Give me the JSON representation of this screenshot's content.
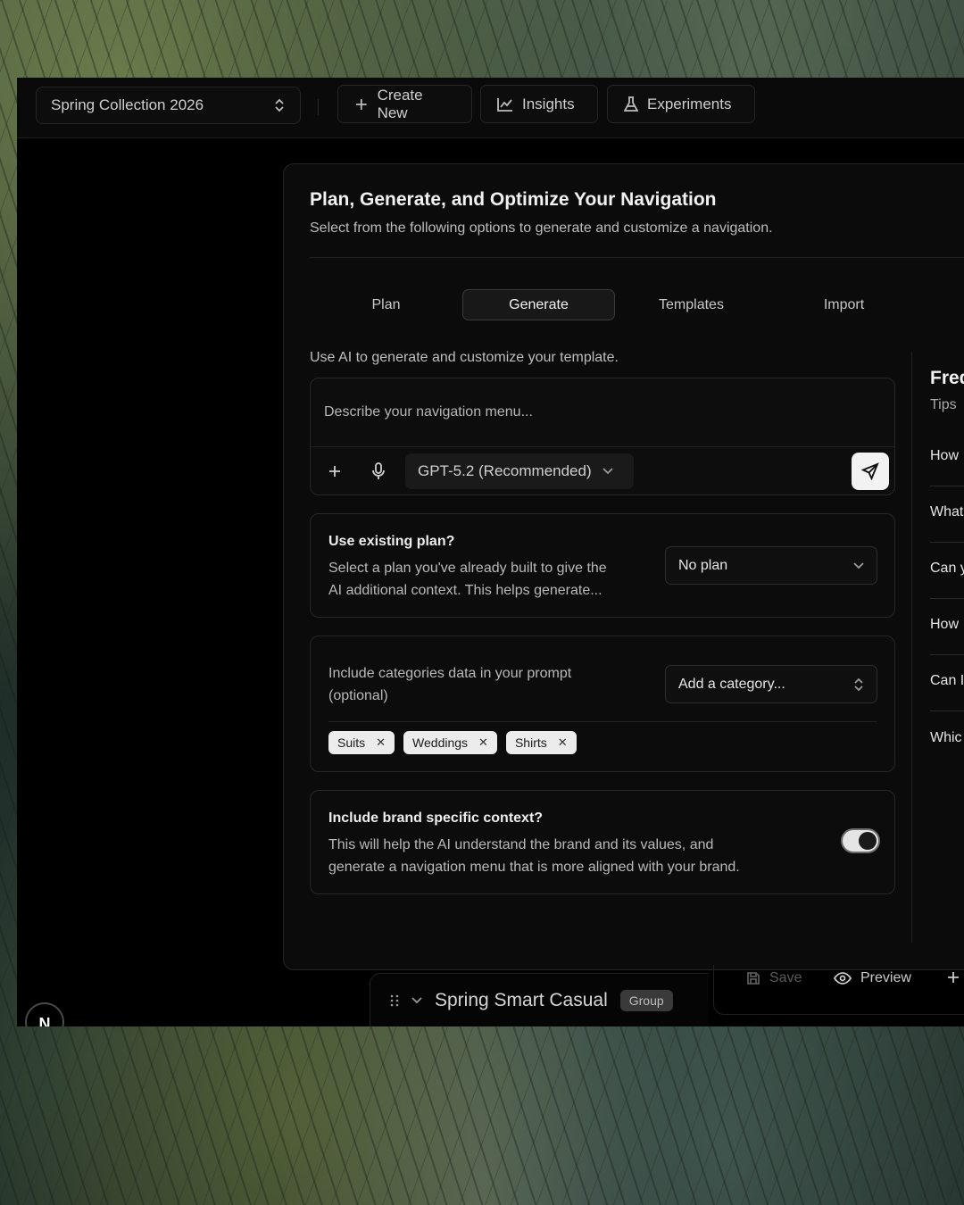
{
  "topbar": {
    "collection": "Spring Collection 2026",
    "buttons": [
      {
        "label": "Create New",
        "icon": "plus-icon"
      },
      {
        "label": "Insights",
        "icon": "chart-line-icon"
      },
      {
        "label": "Experiments",
        "icon": "flask-icon"
      }
    ]
  },
  "dialog": {
    "title": "Plan, Generate, and Optimize Your Navigation",
    "subtitle": "Select from the following options to generate and customize a navigation.",
    "tabs": [
      {
        "label": "Plan",
        "active": false
      },
      {
        "label": "Generate",
        "active": true
      },
      {
        "label": "Templates",
        "active": false
      },
      {
        "label": "Import",
        "active": false
      }
    ],
    "generate_description": "Use AI to generate and customize your template.",
    "prompt": {
      "placeholder": "Describe your navigation menu...",
      "value": "",
      "model": "GPT-5.2 (Recommended)"
    },
    "existing_plan": {
      "title": "Use existing plan?",
      "text_line1": "Select a plan you've already built to give the",
      "text_line2": "AI additional context. This helps generate...",
      "selected": "No plan"
    },
    "categories": {
      "text_line1": "Include categories data in your prompt",
      "text_line2": "(optional)",
      "select_label": "Add a category...",
      "chips": [
        "Suits",
        "Weddings",
        "Shirts"
      ]
    },
    "brand_context": {
      "title": "Include brand specific context?",
      "text_line1": "This will help the AI understand the brand and its values, and",
      "text_line2": "generate a navigation menu that is more aligned with your brand.",
      "enabled": true
    }
  },
  "faq": {
    "title": "Freq",
    "subtitle": "Tips",
    "items": [
      "How",
      "What",
      "Can y",
      "How",
      "Can I",
      "Whic"
    ]
  },
  "bottom": {
    "save_label": "Save",
    "preview_label": "Preview",
    "group_name": "Spring Smart Casual",
    "group_badge": "Group",
    "logo_letter": "N"
  },
  "colors": {
    "background": "#000000",
    "surface": "#0b0b0b",
    "active_tab": "#181818",
    "send_button": "#f2f2f2",
    "chip": "#ececec"
  }
}
